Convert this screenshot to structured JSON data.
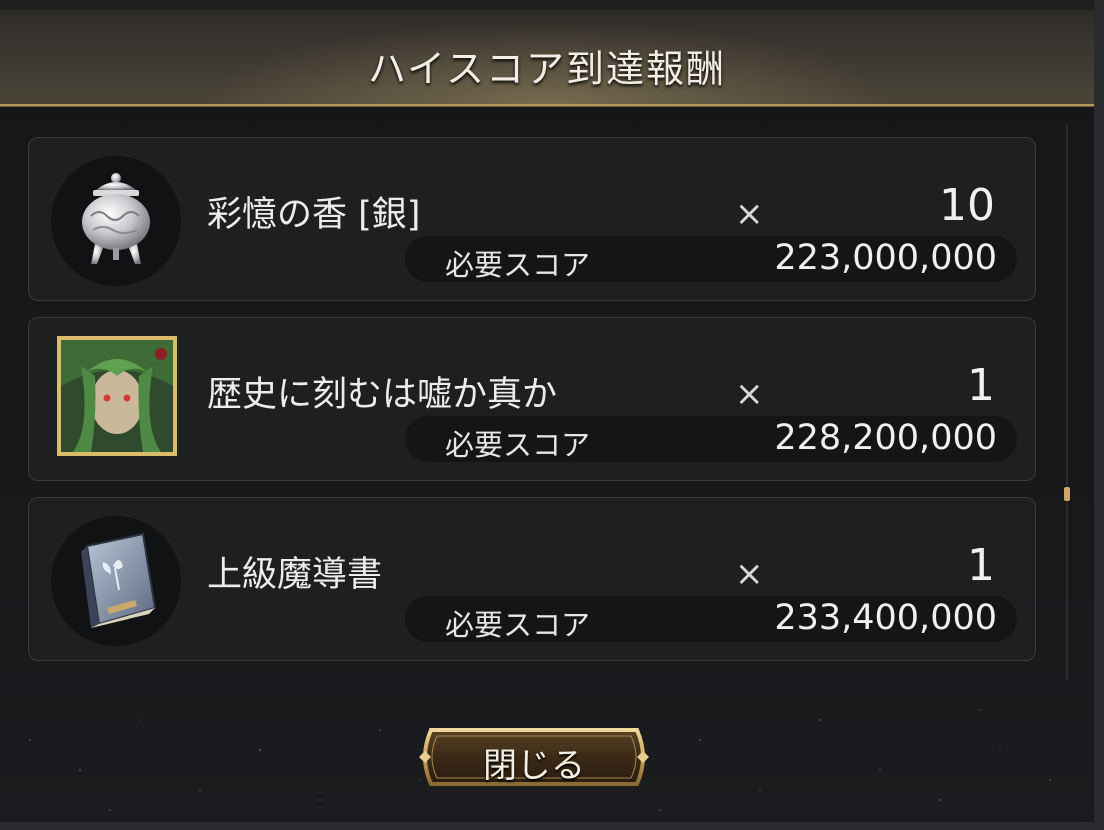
{
  "dialog": {
    "title": "ハイスコア到達報酬",
    "close_label": "閉じる"
  },
  "rewards": [
    {
      "name": "彩憶の香 [銀]",
      "times": "×",
      "qty": "10",
      "score_label": "必要スコア",
      "score": "223,000,000",
      "icon": "silver-incense-burner-icon"
    },
    {
      "name": "歴史に刻むは嘘か真か",
      "times": "×",
      "qty": "1",
      "score_label": "必要スコア",
      "score": "228,200,000",
      "icon": "character-portrait-card-icon"
    },
    {
      "name": "上級魔導書",
      "times": "×",
      "qty": "1",
      "score_label": "必要スコア",
      "score": "233,400,000",
      "icon": "advanced-grimoire-book-icon"
    }
  ],
  "colors": {
    "accent_gold": "#c9a86a",
    "card_border": "#3a3b3e",
    "background": "#151617"
  }
}
